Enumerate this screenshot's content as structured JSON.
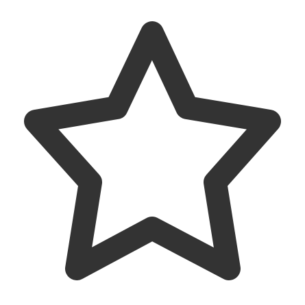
{
  "icon": {
    "name": "star-outline-icon",
    "color": "#333333",
    "background": "#ffffff"
  }
}
